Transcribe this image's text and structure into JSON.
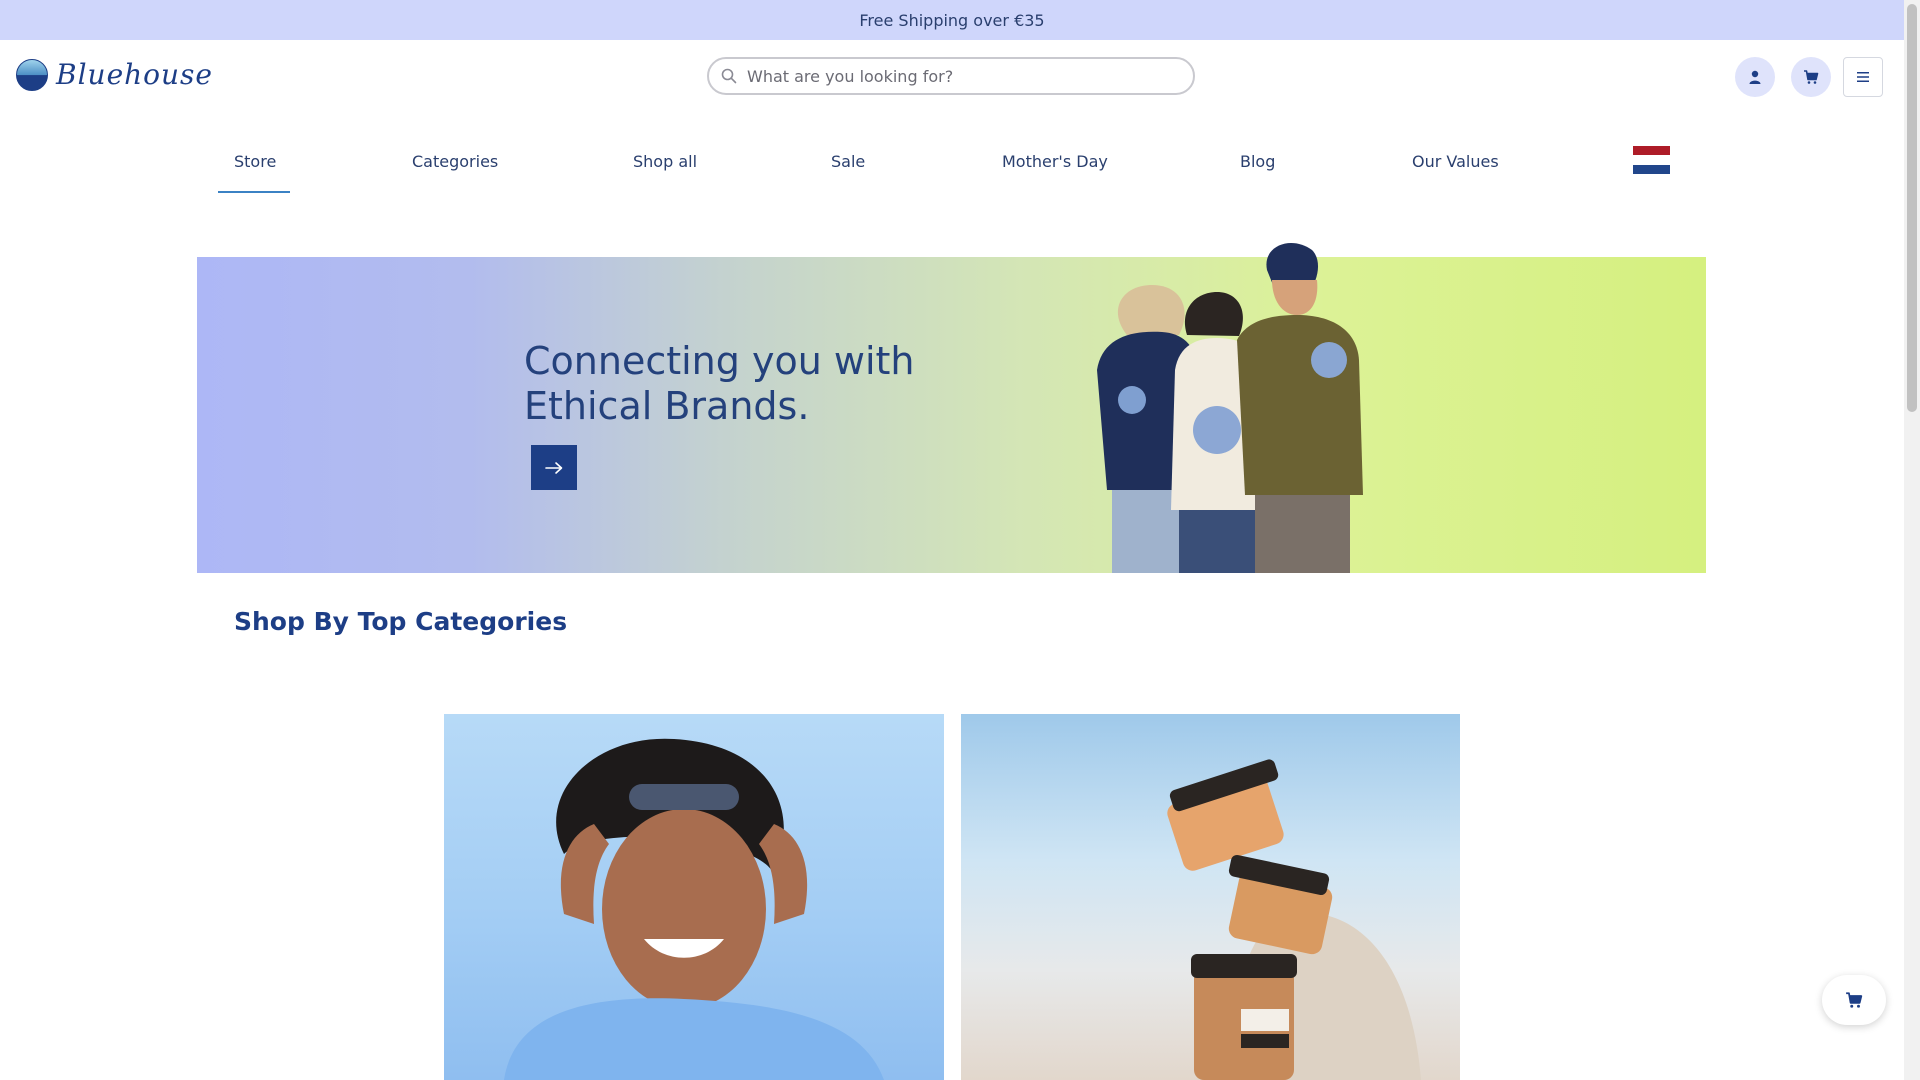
{
  "promo": {
    "text": "Free Shipping over €35"
  },
  "header": {
    "logo_text": "Bluehouse",
    "search": {
      "placeholder": "What are you looking for?",
      "value": ""
    },
    "icons": [
      "search-icon",
      "user-icon",
      "cart-icon",
      "hamburger-menu-icon"
    ]
  },
  "nav": {
    "items": [
      {
        "label": "Store",
        "active": true
      },
      {
        "label": "Categories",
        "active": false
      },
      {
        "label": "Shop all",
        "active": false
      },
      {
        "label": "Sale",
        "active": false
      },
      {
        "label": "Mother's Day",
        "active": false
      },
      {
        "label": "Blog",
        "active": false
      },
      {
        "label": "Our Values",
        "active": false
      }
    ],
    "language_flag": {
      "icon": "netherlands-flag-icon",
      "colors": [
        "#ae1c28",
        "#ffffff",
        "#21468b"
      ]
    }
  },
  "hero": {
    "title": "Connecting you with\nEthical Brands.",
    "cta_icon": "arrow-right-icon"
  },
  "categories": {
    "title": "Shop By Top Categories"
  },
  "colors": {
    "brand": "#1d3e86",
    "promo_bg": "#cfd6fb",
    "accent_underline": "#3b82c4"
  }
}
